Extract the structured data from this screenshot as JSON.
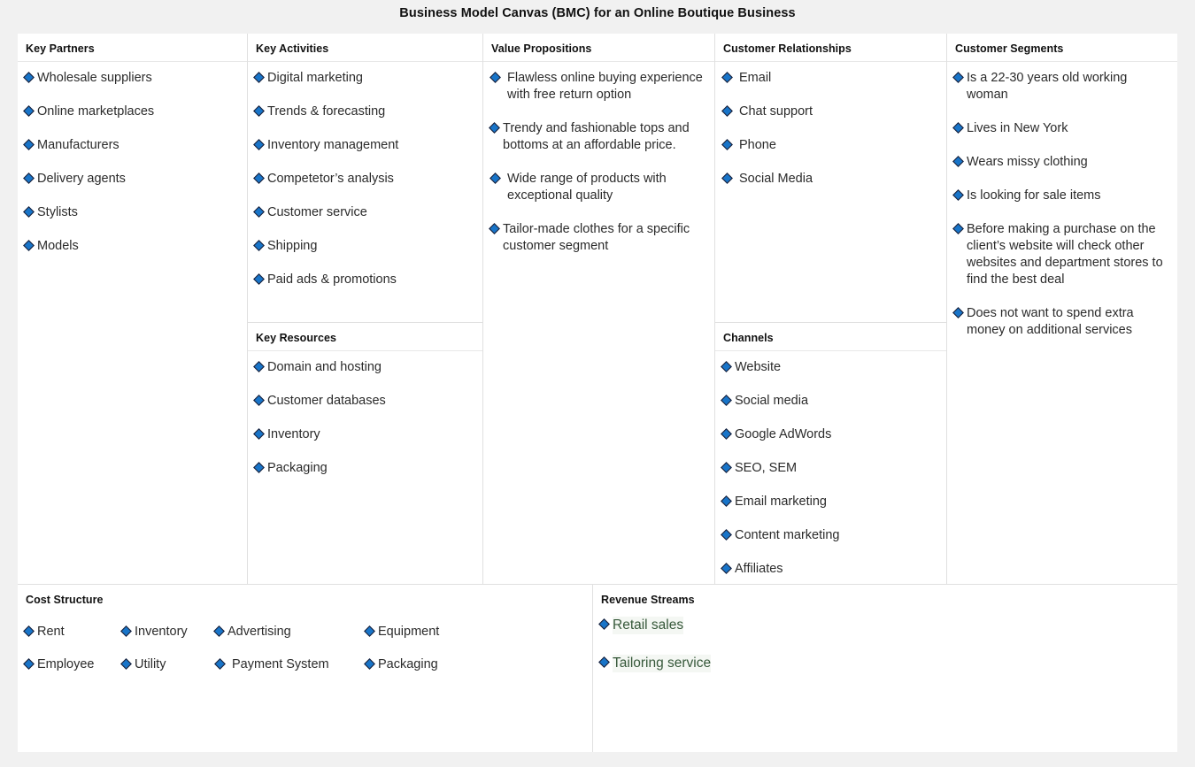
{
  "page": {
    "title": "Business Model Canvas (BMC) for an Online Boutique Business",
    "bullet_icon": "diamond-icon",
    "colors": {
      "bullet": "#1874c8",
      "bullet_outline": "#1a1a2e",
      "text": "#2b2b2b",
      "heading": "#111111",
      "revenue_text": "#36583a",
      "revenue_highlight": "#f4f7f3",
      "canvas": "#ffffff",
      "page_background": "#f1f1f1",
      "cell_border": "#e0e0e0"
    }
  },
  "blocks": {
    "key_partners": {
      "title": "Key Partners",
      "items": [
        "Wholesale suppliers",
        "Online marketplaces",
        "Manufacturers",
        "Delivery agents",
        "Stylists",
        "Models"
      ]
    },
    "key_activities": {
      "title": "Key Activities",
      "items": [
        "Digital marketing",
        "Trends & forecasting",
        "Inventory management",
        "Competetor’s analysis",
        "Customer service",
        "Shipping",
        "Paid ads & promotions"
      ]
    },
    "key_resources": {
      "title": "Key Resources",
      "items": [
        "Domain and hosting",
        "Customer databases",
        "Inventory",
        "Packaging"
      ]
    },
    "value_propositions": {
      "title": "Value Propositions",
      "items": [
        "Flawless online buying experience with free return option",
        "Trendy and fashionable tops and bottoms at an affordable price.",
        "Wide range of products with exceptional quality",
        "Tailor-made clothes for a specific customer segment"
      ]
    },
    "customer_relationships": {
      "title": "Customer Relationships",
      "items": [
        "Email",
        "Chat support",
        "Phone",
        "Social Media"
      ]
    },
    "channels": {
      "title": "Channels",
      "items": [
        "Website",
        "Social media",
        "Google AdWords",
        "SEO, SEM",
        "Email marketing",
        "Content marketing",
        "Affiliates"
      ]
    },
    "customer_segments": {
      "title": "Customer Segments",
      "items": [
        "Is a 22-30 years old working woman",
        "Lives in New York",
        "Wears missy clothing",
        "Is looking for sale items",
        "Before making a purchase on the client’s website will check other websites and department stores to find the best deal",
        "Does not want to spend extra money on additional services"
      ]
    },
    "cost_structure": {
      "title": "Cost Structure",
      "rows": [
        [
          "Rent",
          "Inventory",
          "Advertising",
          "Equipment"
        ],
        [
          "Employee",
          "Utility",
          "Payment System",
          "Packaging"
        ]
      ]
    },
    "revenue_streams": {
      "title": "Revenue Streams",
      "items": [
        "Retail sales",
        "Tailoring service"
      ]
    }
  }
}
